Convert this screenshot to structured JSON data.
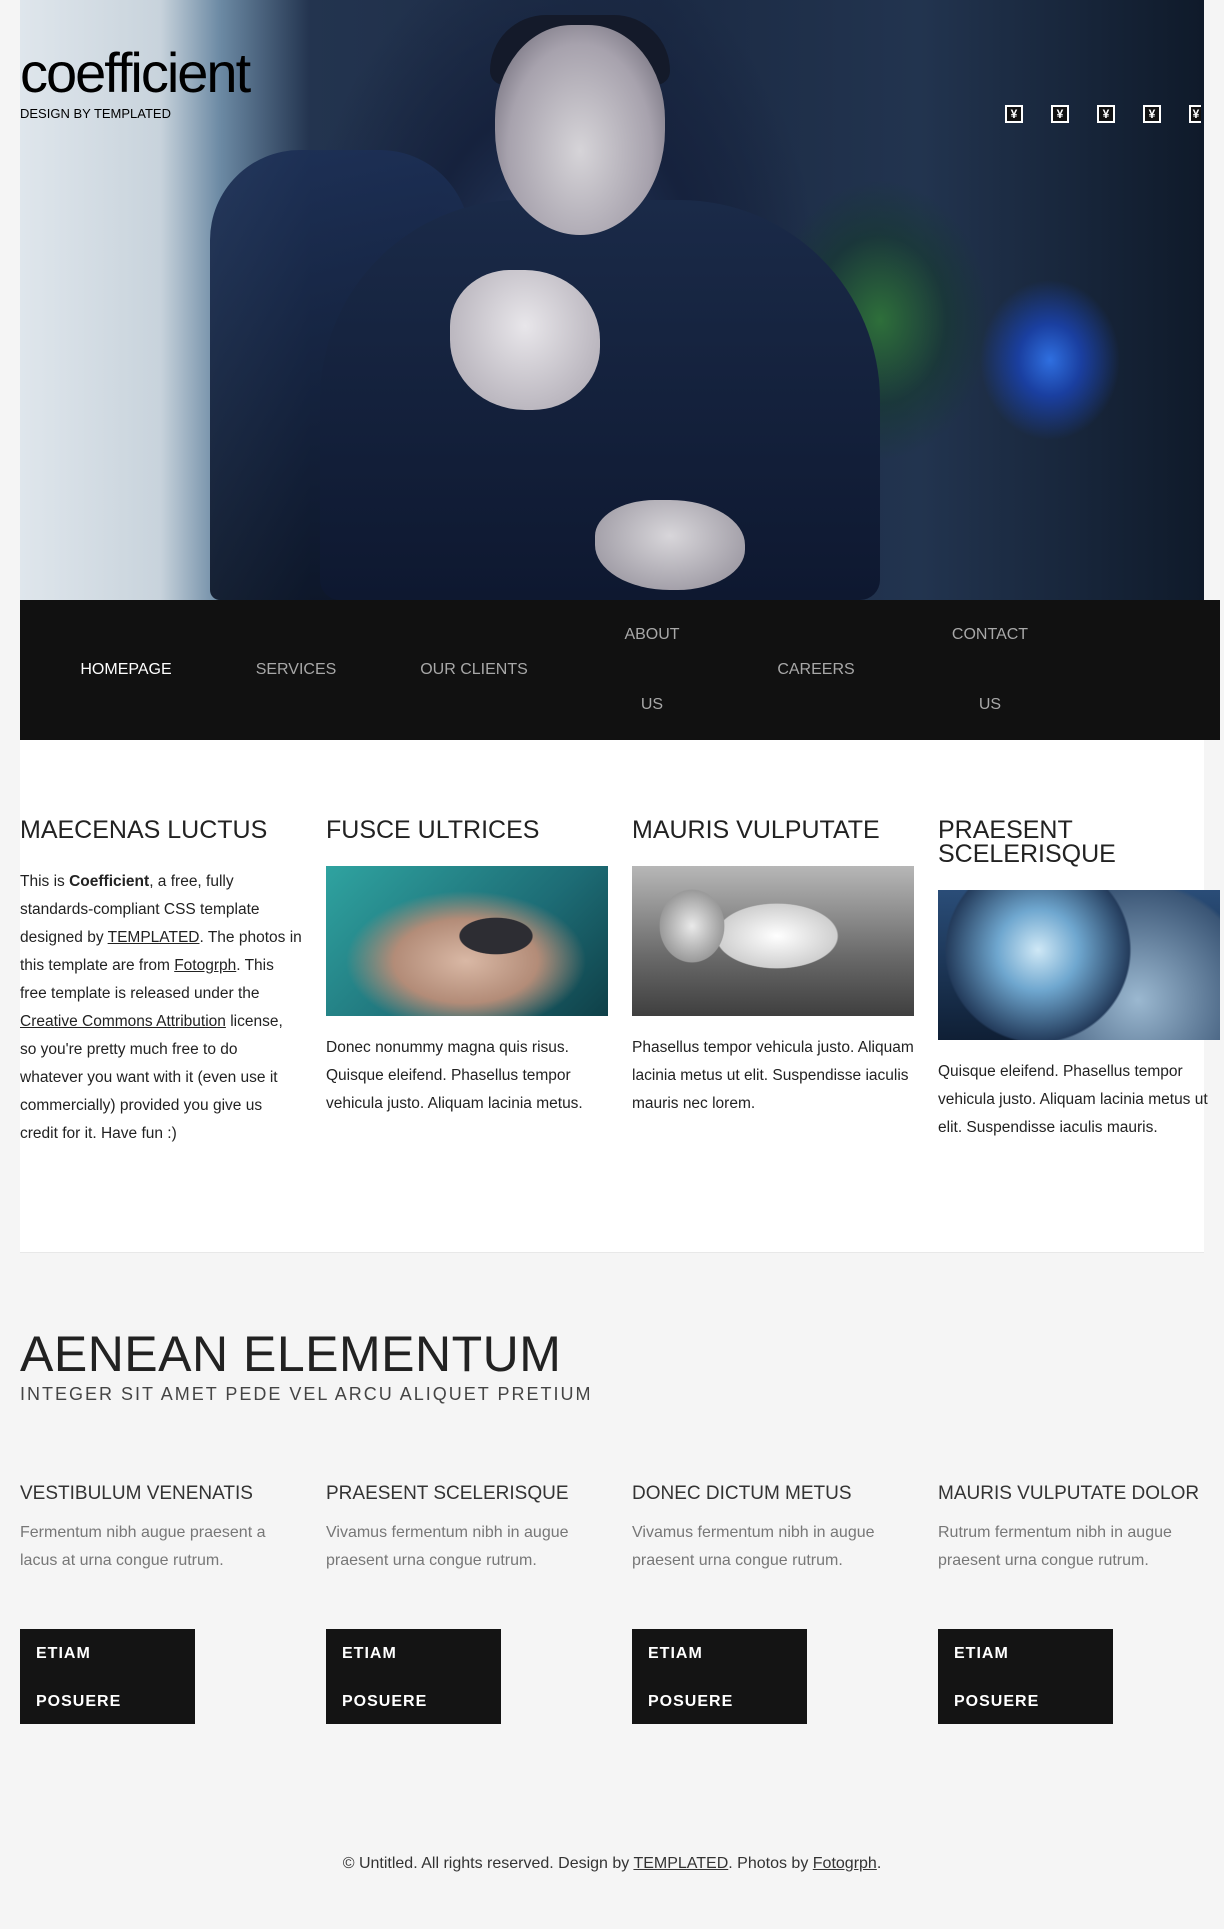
{
  "header": {
    "title": "coefficient",
    "subtitle": "DESIGN BY TEMPLATED",
    "social_icons": [
      "social-icon",
      "social-icon",
      "social-icon",
      "social-icon",
      "social-icon"
    ]
  },
  "nav": {
    "items": [
      {
        "label": "HOMEPAGE",
        "active": true
      },
      {
        "label": "SERVICES"
      },
      {
        "label": "OUR CLIENTS"
      },
      {
        "label_line1": "ABOUT",
        "label_line2": "US"
      },
      {
        "label": "CAREERS"
      },
      {
        "label_line1": "CONTACT",
        "label_line2": "US"
      }
    ]
  },
  "columns": [
    {
      "title": "MAECENAS LUCTUS",
      "p1": "This is ",
      "bold": "Coefficient",
      "p2": ", a free, fully standards-compliant CSS template designed by ",
      "link1": "TEMPLATED",
      "p3": ". The photos in this template are from ",
      "link2": "Fotogrph",
      "p4": ". This free template is released under the ",
      "link3": "Creative Commons Attribution",
      "p5": " license, so you're pretty much free to do whatever you want with it (even use it commercially) provided you give us credit for it. Have fun :)"
    },
    {
      "title": "FUSCE ULTRICES",
      "text": "Donec nonummy magna quis risus. Quisque eleifend. Phasellus tempor vehicula justo. Aliquam lacinia metus."
    },
    {
      "title": "MAURIS VULPUTATE",
      "text": "Phasellus tempor vehicula justo. Aliquam lacinia metus ut elit. Suspendisse iaculis mauris nec lorem."
    },
    {
      "title": "PRAESENT SCELERISQUE",
      "text": "Quisque eleifend. Phasellus tempor vehicula justo. Aliquam lacinia metus ut elit. Suspendisse iaculis mauris."
    }
  ],
  "section": {
    "title": "AENEAN ELEMENTUM",
    "subtitle": "INTEGER SIT AMET PEDE VEL ARCU ALIQUET PRETIUM"
  },
  "features": [
    {
      "title": "VESTIBULUM VENENATIS",
      "text": "Fermentum nibh augue praesent a lacus at urna congue rutrum.",
      "btn_line1": "ETIAM",
      "btn_line2": "POSUERE"
    },
    {
      "title": "PRAESENT SCELERISQUE",
      "text": "Vivamus fermentum nibh in augue praesent urna congue rutrum.",
      "btn_line1": "ETIAM",
      "btn_line2": "POSUERE"
    },
    {
      "title": "DONEC DICTUM METUS",
      "text": "Vivamus fermentum nibh in augue praesent urna congue rutrum.",
      "btn_line1": "ETIAM",
      "btn_line2": "POSUERE"
    },
    {
      "title": "MAURIS VULPUTATE DOLOR",
      "text": "Rutrum fermentum nibh in augue praesent urna congue rutrum.",
      "btn_line1": "ETIAM",
      "btn_line2": "POSUERE"
    }
  ],
  "footer": {
    "t1": "© Untitled. All rights reserved. Design by ",
    "link1": "TEMPLATED",
    "t2": ". Photos by ",
    "link2": "Fotogrph",
    "t3": "."
  },
  "colors": {
    "nav_bg": "#111111",
    "button_bg": "#141414",
    "page_bg": "#f5f5f5"
  }
}
